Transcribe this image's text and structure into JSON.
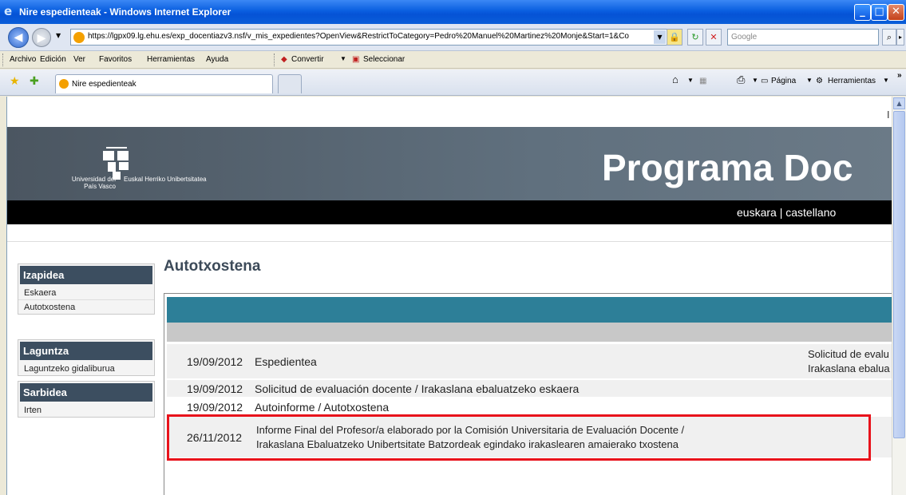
{
  "window": {
    "title": "Nire espedienteak - Windows Internet Explorer"
  },
  "address_bar": {
    "url": "https://lgpx09.lg.ehu.es/exp_docentiazv3.nsf/v_mis_expedientes?OpenView&RestrictToCategory=Pedro%20Manuel%20Martinez%20Monje&Start=1&Co",
    "search_placeholder": "Google"
  },
  "menu": {
    "items": [
      "Archivo",
      "Edición",
      "Ver",
      "Favoritos",
      "Herramientas",
      "Ayuda"
    ],
    "convertir": "Convertir",
    "seleccionar": "Seleccionar"
  },
  "tabs": {
    "active_label": "Nire espedienteak"
  },
  "command_bar": {
    "pagina": "Página",
    "herramientas": "Herramientas"
  },
  "banner": {
    "logo_left": "Universidad del País Vasco",
    "logo_right": "Euskal Herriko Unibertsitatea",
    "program_title": "Programa Doc",
    "lang_euskara": "euskara",
    "lang_sep": "|",
    "lang_castellano": "castellano",
    "edge_char": "I"
  },
  "sidebar": {
    "sections": [
      {
        "title": "Izapidea",
        "links": [
          "Eskaera",
          "Autotxostena"
        ]
      },
      {
        "title": "Laguntza",
        "links": [
          "Laguntzeko gidaliburua"
        ]
      },
      {
        "title": "Sarbidea",
        "links": [
          "Irten"
        ]
      }
    ]
  },
  "main": {
    "title": "Autotxostena",
    "rows": [
      {
        "date": "19/09/2012",
        "desc": "Espedientea",
        "right1": "Solicitud de evalu",
        "right2": "Irakaslana ebalua"
      },
      {
        "date": "19/09/2012",
        "desc": "Solicitud de evaluación docente / Irakaslana ebaluatzeko eskaera"
      },
      {
        "date": "19/09/2012",
        "desc": "Autoinforme / Autotxostena"
      },
      {
        "date": "26/11/2012",
        "desc1": "Informe Final del Profesor/a elaborado por la Comisión Universitaria de Evaluación Docente /",
        "desc2": "Irakaslana Ebaluatzeko Unibertsitate Batzordeak egindako irakaslearen amaierako txostena"
      }
    ]
  },
  "colors": {
    "titlebar": "#0a5fe0",
    "banner": "#5b6a78",
    "teal": "#2d7f98",
    "sidebar_head": "#3c4e60",
    "highlight": "#e8121b"
  }
}
